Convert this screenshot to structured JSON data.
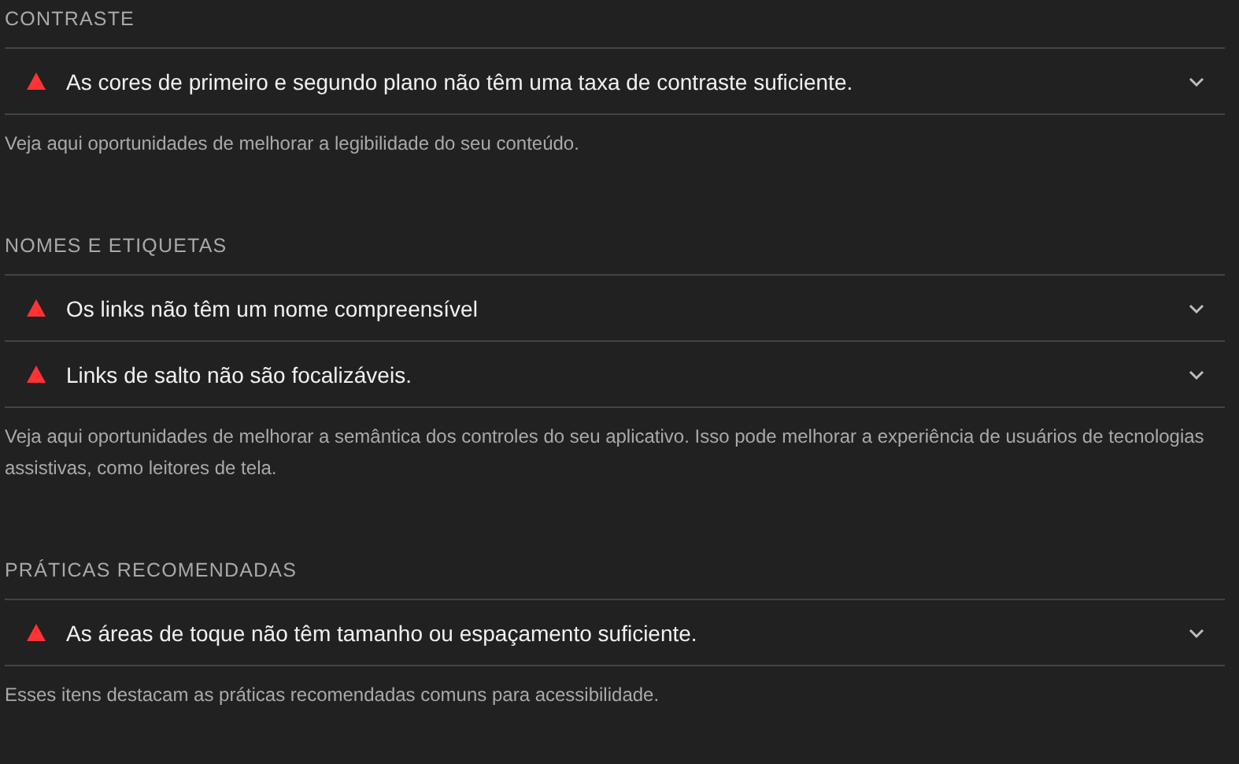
{
  "sections": [
    {
      "title": "CONTRASTE",
      "audits": [
        {
          "label": "As cores de primeiro e segundo plano não têm uma taxa de contraste suficiente.",
          "expanded": false
        }
      ],
      "description": "Veja aqui oportunidades de melhorar a legibilidade do seu conteúdo."
    },
    {
      "title": "NOMES E ETIQUETAS",
      "audits": [
        {
          "label": "Os links não têm um nome compreensível",
          "expanded": false
        },
        {
          "label": "Links de salto não são focalizáveis.",
          "expanded": false
        }
      ],
      "description": "Veja aqui oportunidades de melhorar a semântica dos controles do seu aplicativo. Isso pode melhorar a experiência de usuários de tecnologias assistivas, como leitores de tela."
    },
    {
      "title": "PRÁTICAS RECOMENDADAS",
      "audits": [
        {
          "label": "As áreas de toque não têm tamanho ou espaçamento suficiente.",
          "expanded": false
        }
      ],
      "description": "Esses itens destacam as práticas recomendadas comuns para acessibilidade."
    }
  ]
}
